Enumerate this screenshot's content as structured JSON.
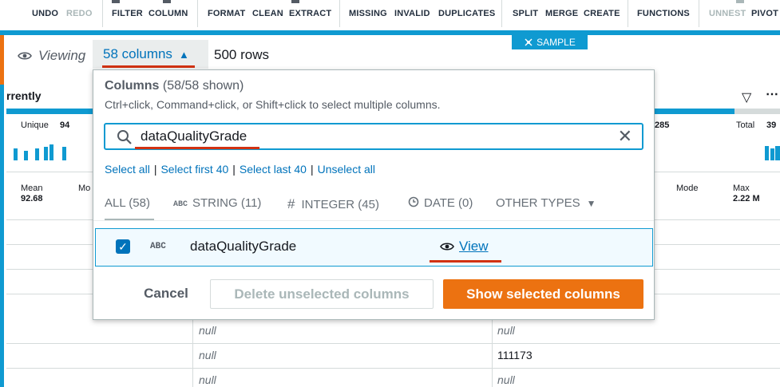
{
  "toolbar": {
    "items": [
      "UNDO",
      "REDO",
      "FILTER",
      "COLUMN",
      "FORMAT",
      "CLEAN",
      "EXTRACT",
      "MISSING",
      "INVALID",
      "DUPLICATES",
      "SPLIT",
      "MERGE",
      "CREATE",
      "FUNCTIONS",
      "UNNEST",
      "PIVOT"
    ]
  },
  "sample_badge": "SAMPLE",
  "viewing": {
    "label": "Viewing",
    "columns_label": "58 columns",
    "rows_label": "500 rows"
  },
  "background": {
    "col_header": "rrently",
    "unique_label": "Unique",
    "unique_value": "94",
    "right_value": "285",
    "total_label": "Total",
    "total_value": "39",
    "mean_label": "Mean",
    "mean_value": "92.68",
    "mo_label": "Mo",
    "mode_label": "Mode",
    "max_label": "Max",
    "max_value": "2.22 M",
    "cells": [
      {
        "a": "null",
        "b": "null"
      },
      {
        "a": "null",
        "b": "111173"
      },
      {
        "a": "null",
        "b": "null"
      }
    ]
  },
  "panel": {
    "title": "Columns",
    "title_count": "(58/58 shown)",
    "hint": "Ctrl+click, Command+click, or Shift+click to select multiple columns.",
    "search_value": "dataQualityGrade",
    "links": [
      "Select all",
      "Select first 40",
      "Select last 40",
      "Unselect all"
    ],
    "tabs": {
      "all": "ALL (58)",
      "string": "STRING (11)",
      "integer": "INTEGER (45)",
      "date": "DATE (0)",
      "other": "OTHER TYPES"
    },
    "type_icon_abc": "ABC",
    "row": {
      "type": "ABC",
      "name": "dataQualityGrade",
      "view_label": "View"
    },
    "buttons": {
      "cancel": "Cancel",
      "delete": "Delete unselected columns",
      "show": "Show selected columns"
    }
  },
  "colors": {
    "accent": "#0f9ad1",
    "link": "#0073bb",
    "primary_button": "#ec7211",
    "highlight_underline": "#d13212"
  }
}
